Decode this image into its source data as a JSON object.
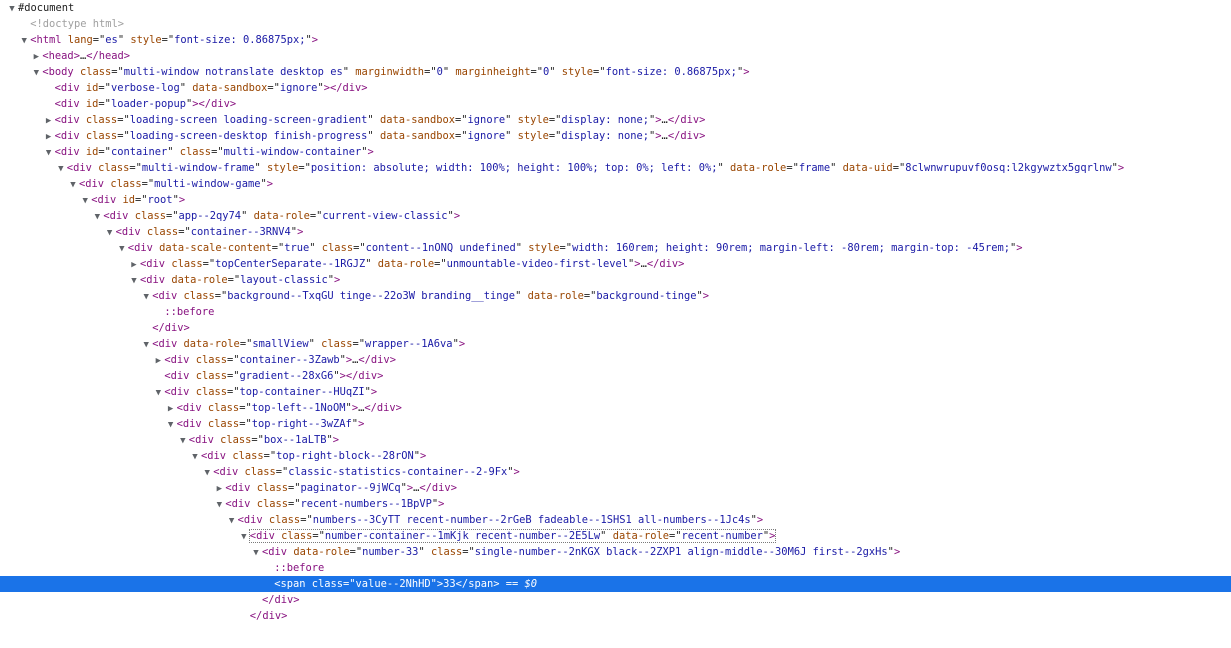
{
  "rows": [
    {
      "depth": 0,
      "toggle": "open",
      "kind": "document",
      "text": "#document"
    },
    {
      "depth": 1,
      "toggle": "none",
      "kind": "doctype",
      "text": "<!doctype html>"
    },
    {
      "depth": 1,
      "toggle": "open",
      "kind": "open",
      "tag": "html",
      "attrs": [
        [
          "lang",
          "es"
        ],
        [
          "style",
          "font-size: 0.86875px;"
        ]
      ]
    },
    {
      "depth": 2,
      "toggle": "closed",
      "kind": "collapsed",
      "tag": "head",
      "attrs": []
    },
    {
      "depth": 2,
      "toggle": "open",
      "kind": "open",
      "tag": "body",
      "attrs": [
        [
          "class",
          "multi-window notranslate desktop es"
        ],
        [
          "marginwidth",
          "0"
        ],
        [
          "marginheight",
          "0"
        ],
        [
          "style",
          "font-size: 0.86875px;"
        ]
      ]
    },
    {
      "depth": 3,
      "toggle": "none",
      "kind": "empty",
      "tag": "div",
      "attrs": [
        [
          "id",
          "verbose-log"
        ],
        [
          "data-sandbox",
          "ignore"
        ]
      ]
    },
    {
      "depth": 3,
      "toggle": "none",
      "kind": "empty",
      "tag": "div",
      "attrs": [
        [
          "id",
          "loader-popup"
        ]
      ]
    },
    {
      "depth": 3,
      "toggle": "closed",
      "kind": "collapsed",
      "tag": "div",
      "attrs": [
        [
          "class",
          "loading-screen loading-screen-gradient"
        ],
        [
          "data-sandbox",
          "ignore"
        ],
        [
          "style",
          "display: none;"
        ]
      ]
    },
    {
      "depth": 3,
      "toggle": "closed",
      "kind": "collapsed",
      "tag": "div",
      "attrs": [
        [
          "class",
          "loading-screen-desktop finish-progress"
        ],
        [
          "data-sandbox",
          "ignore"
        ],
        [
          "style",
          "display: none;"
        ]
      ]
    },
    {
      "depth": 3,
      "toggle": "open",
      "kind": "open",
      "tag": "div",
      "attrs": [
        [
          "id",
          "container"
        ],
        [
          "class",
          "multi-window-container"
        ]
      ]
    },
    {
      "depth": 4,
      "toggle": "open",
      "kind": "open",
      "tag": "div",
      "attrs": [
        [
          "class",
          "multi-window-frame"
        ],
        [
          "style",
          "position: absolute; width: 100%; height: 100%; top: 0%; left: 0%;"
        ],
        [
          "data-role",
          "frame"
        ],
        [
          "data-uid",
          "8clwnwrupuvf0osq:l2kgywztx5gqrlnw"
        ]
      ]
    },
    {
      "depth": 5,
      "toggle": "open",
      "kind": "open",
      "tag": "div",
      "attrs": [
        [
          "class",
          "multi-window-game"
        ]
      ]
    },
    {
      "depth": 6,
      "toggle": "open",
      "kind": "open",
      "tag": "div",
      "attrs": [
        [
          "id",
          "root"
        ]
      ]
    },
    {
      "depth": 7,
      "toggle": "open",
      "kind": "open",
      "tag": "div",
      "attrs": [
        [
          "class",
          "app--2qy74"
        ],
        [
          "data-role",
          "current-view-classic"
        ]
      ]
    },
    {
      "depth": 8,
      "toggle": "open",
      "kind": "open",
      "tag": "div",
      "attrs": [
        [
          "class",
          "container--3RNV4"
        ]
      ]
    },
    {
      "depth": 9,
      "toggle": "open",
      "kind": "open",
      "tag": "div",
      "attrs": [
        [
          "data-scale-content",
          "true"
        ],
        [
          "class",
          "content--1nONQ undefined"
        ],
        [
          "style",
          "width: 160rem; height: 90rem; margin-left: -80rem; margin-top: -45rem;"
        ]
      ]
    },
    {
      "depth": 10,
      "toggle": "closed",
      "kind": "collapsed",
      "tag": "div",
      "attrs": [
        [
          "class",
          "topCenterSeparate--1RGJZ"
        ],
        [
          "data-role",
          "unmountable-video-first-level"
        ]
      ]
    },
    {
      "depth": 10,
      "toggle": "open",
      "kind": "open",
      "tag": "div",
      "attrs": [
        [
          "data-role",
          "layout-classic"
        ]
      ]
    },
    {
      "depth": 11,
      "toggle": "open",
      "kind": "open",
      "tag": "div",
      "attrs": [
        [
          "class",
          "background--TxqGU tinge--22o3W branding__tinge"
        ],
        [
          "data-role",
          "background-tinge"
        ]
      ]
    },
    {
      "depth": 12,
      "toggle": "none",
      "kind": "pseudo",
      "text": "::before"
    },
    {
      "depth": 11,
      "toggle": "none",
      "kind": "close",
      "tag": "div"
    },
    {
      "depth": 11,
      "toggle": "open",
      "kind": "open",
      "tag": "div",
      "attrs": [
        [
          "data-role",
          "smallView"
        ],
        [
          "class",
          "wrapper--1A6va"
        ]
      ]
    },
    {
      "depth": 12,
      "toggle": "closed",
      "kind": "collapsed",
      "tag": "div",
      "attrs": [
        [
          "class",
          "container--3Zawb"
        ]
      ]
    },
    {
      "depth": 12,
      "toggle": "none",
      "kind": "empty",
      "tag": "div",
      "attrs": [
        [
          "class",
          "gradient--28xG6"
        ]
      ]
    },
    {
      "depth": 12,
      "toggle": "open",
      "kind": "open",
      "tag": "div",
      "attrs": [
        [
          "class",
          "top-container--HUqZI"
        ]
      ]
    },
    {
      "depth": 13,
      "toggle": "closed",
      "kind": "collapsed",
      "tag": "div",
      "attrs": [
        [
          "class",
          "top-left--1NoOM"
        ]
      ]
    },
    {
      "depth": 13,
      "toggle": "open",
      "kind": "open",
      "tag": "div",
      "attrs": [
        [
          "class",
          "top-right--3wZAf"
        ]
      ]
    },
    {
      "depth": 14,
      "toggle": "open",
      "kind": "open",
      "tag": "div",
      "attrs": [
        [
          "class",
          "box--1aLTB"
        ]
      ]
    },
    {
      "depth": 15,
      "toggle": "open",
      "kind": "open",
      "tag": "div",
      "attrs": [
        [
          "class",
          "top-right-block--28rON"
        ]
      ]
    },
    {
      "depth": 16,
      "toggle": "open",
      "kind": "open",
      "tag": "div",
      "attrs": [
        [
          "class",
          "classic-statistics-container--2-9Fx"
        ]
      ]
    },
    {
      "depth": 17,
      "toggle": "closed",
      "kind": "collapsed",
      "tag": "div",
      "attrs": [
        [
          "class",
          "paginator--9jWCq"
        ]
      ]
    },
    {
      "depth": 17,
      "toggle": "open",
      "kind": "open",
      "tag": "div",
      "attrs": [
        [
          "class",
          "recent-numbers--1BpVP"
        ]
      ]
    },
    {
      "depth": 18,
      "toggle": "open",
      "kind": "open",
      "tag": "div",
      "attrs": [
        [
          "class",
          "numbers--3CyTT recent-number--2rGeB fadeable--1SHS1 all-numbers--1Jc4s"
        ]
      ]
    },
    {
      "depth": 19,
      "toggle": "open",
      "kind": "open",
      "hoverBox": true,
      "tag": "div",
      "attrs": [
        [
          "class",
          "number-container--1mKjk recent-number--2E5Lw"
        ],
        [
          "data-role",
          "recent-number"
        ]
      ]
    },
    {
      "depth": 20,
      "toggle": "open",
      "kind": "open",
      "tag": "div",
      "attrs": [
        [
          "data-role",
          "number-33"
        ],
        [
          "class",
          "single-number--2nKGX black--2ZXP1 align-middle--30M6J first--2gxHs"
        ]
      ]
    },
    {
      "depth": 21,
      "toggle": "none",
      "kind": "pseudo",
      "text": "::before"
    },
    {
      "depth": 21,
      "toggle": "none",
      "kind": "inline",
      "selected": true,
      "tag": "span",
      "attrs": [
        [
          "class",
          "value--2NhHD"
        ]
      ],
      "content": "33",
      "suffix": " == $0"
    },
    {
      "depth": 20,
      "toggle": "none",
      "kind": "close",
      "tag": "div"
    },
    {
      "depth": 19,
      "toggle": "none",
      "kind": "close",
      "tag": "div"
    }
  ],
  "ellipsis": "…",
  "colors": {
    "tag": "#881280",
    "attr_name": "#994500",
    "attr_value": "#1a1aa6",
    "selection": "#1a73e8"
  }
}
